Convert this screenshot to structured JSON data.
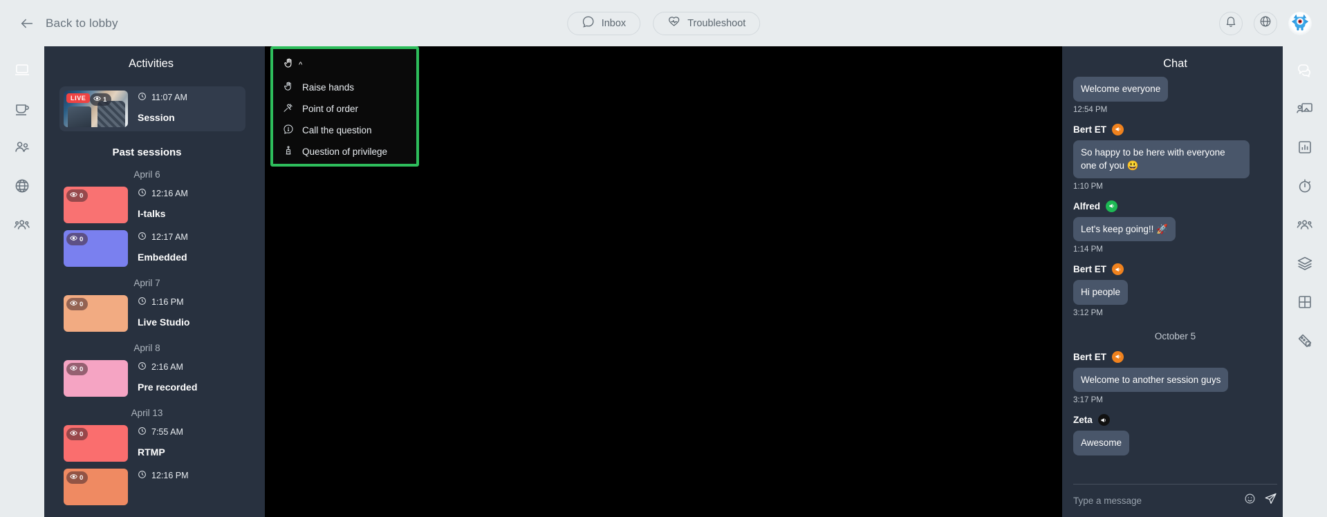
{
  "topbar": {
    "back_label": "Back to lobby",
    "back_icon": "arrow-left-icon",
    "pills": [
      {
        "label": "Inbox",
        "icon": "chat-bubble-icon"
      },
      {
        "label": "Troubleshoot",
        "icon": "heartbeat-icon"
      }
    ],
    "notifications_icon": "bell-icon",
    "language_icon": "globe-icon",
    "avatar_icon": "user-avatar-monster"
  },
  "left_rail": {
    "items": [
      {
        "name": "stage",
        "icon": "laptop-icon",
        "active": true
      },
      {
        "name": "lounge",
        "icon": "coffee-cup-icon",
        "active": false
      },
      {
        "name": "people",
        "icon": "two-people-icon",
        "active": false
      },
      {
        "name": "network",
        "icon": "globe-icon",
        "active": false
      },
      {
        "name": "groups",
        "icon": "group-people-icon",
        "active": false
      }
    ]
  },
  "activities": {
    "title": "Activities",
    "past_sessions_label": "Past sessions",
    "live_session": {
      "badge": "LIVE",
      "viewers": "1",
      "time": "11:07 AM",
      "name": "Session",
      "clock_icon": "clock-icon",
      "eye_icon": "eye-icon"
    },
    "groups": [
      {
        "date": "April 6",
        "sessions": [
          {
            "viewers": "0",
            "time": "12:16 AM",
            "name": "I-talks",
            "color": "#f97272"
          },
          {
            "viewers": "0",
            "time": "12:17 AM",
            "name": "Embedded",
            "color": "#7a80ef"
          }
        ]
      },
      {
        "date": "April 7",
        "sessions": [
          {
            "viewers": "0",
            "time": "1:16 PM",
            "name": "Live Studio",
            "color": "#f2ab82"
          }
        ]
      },
      {
        "date": "April 8",
        "sessions": [
          {
            "viewers": "0",
            "time": "2:16 AM",
            "name": "Pre recorded",
            "color": "#f5a4c3"
          }
        ]
      },
      {
        "date": "April 13",
        "sessions": [
          {
            "viewers": "0",
            "time": "7:55 AM",
            "name": "RTMP",
            "color": "#fa6e6e"
          },
          {
            "viewers": "0",
            "time": "12:16 PM",
            "name": "",
            "color": "#ef8a62"
          }
        ]
      }
    ]
  },
  "popup_menu": {
    "header_icon": "raise-hand-icon",
    "chevron": "^",
    "items": [
      {
        "label": "Raise hands",
        "icon": "raise-hand-icon"
      },
      {
        "label": "Point of order",
        "icon": "gavel-icon"
      },
      {
        "label": "Call the question",
        "icon": "question-bubble-icon"
      },
      {
        "label": "Question of privilege",
        "icon": "podium-icon"
      }
    ],
    "border_color": "#2ebd5c",
    "background": "#0a0a0a"
  },
  "chat": {
    "title": "Chat",
    "messages": [
      {
        "author": "",
        "badge_color": "",
        "text": "Welcome everyone",
        "time": "12:54 PM"
      },
      {
        "author": "Bert ET",
        "badge_color": "#f0821e",
        "text": "So happy to be here with everyone one of you 😃",
        "time": "1:10 PM"
      },
      {
        "author": "Alfred",
        "badge_color": "#1db954",
        "text": "Let's keep going!! 🚀",
        "time": "1:14 PM"
      },
      {
        "author": "Bert ET",
        "badge_color": "#f0821e",
        "text": "Hi people",
        "time": "3:12 PM"
      }
    ],
    "date_separator": "October 5",
    "messages_after": [
      {
        "author": "Bert ET",
        "badge_color": "#f0821e",
        "text": "Welcome to another session guys",
        "time": "3:17 PM"
      },
      {
        "author": "Zeta",
        "badge_color": "#111111",
        "text": "Awesome",
        "time": ""
      }
    ],
    "input_placeholder": "Type a message",
    "emoji_icon": "emoji-icon",
    "send_icon": "send-paper-plane-icon"
  },
  "right_rail": {
    "items": [
      {
        "name": "chat",
        "icon": "chat-bubbles-icon",
        "active": true
      },
      {
        "name": "screen-share",
        "icon": "presentation-icon",
        "active": false
      },
      {
        "name": "polls",
        "icon": "bar-chart-icon",
        "active": false
      },
      {
        "name": "timer",
        "icon": "stopwatch-icon",
        "active": false
      },
      {
        "name": "participants",
        "icon": "group-people-icon",
        "active": false
      },
      {
        "name": "layers",
        "icon": "layers-icon",
        "active": false
      },
      {
        "name": "grid",
        "icon": "grid-icon",
        "active": false
      },
      {
        "name": "games",
        "icon": "puzzle-icon",
        "active": false
      }
    ]
  }
}
